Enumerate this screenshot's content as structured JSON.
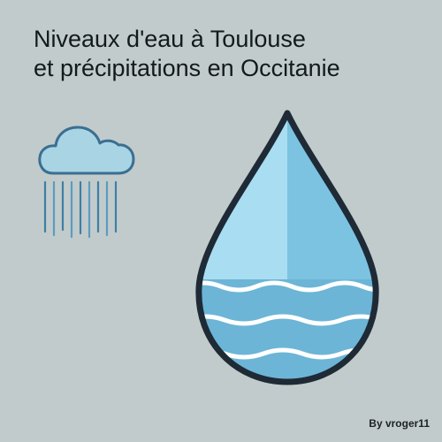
{
  "title": {
    "line1": "Niveaux d'eau à Toulouse",
    "line2": "et précipitations en Occitanie"
  },
  "icons": {
    "rain": "rain-cloud-icon",
    "drop": "water-drop-icon"
  },
  "credit": "By vroger11",
  "colors": {
    "background": "#c2cbcb",
    "drop_light": "#8fd3ec",
    "drop_dark": "#5ba8c8",
    "outline": "#1e2a35",
    "cloud": "#a9d4e4",
    "rain_lines": "#4e8fb4"
  }
}
